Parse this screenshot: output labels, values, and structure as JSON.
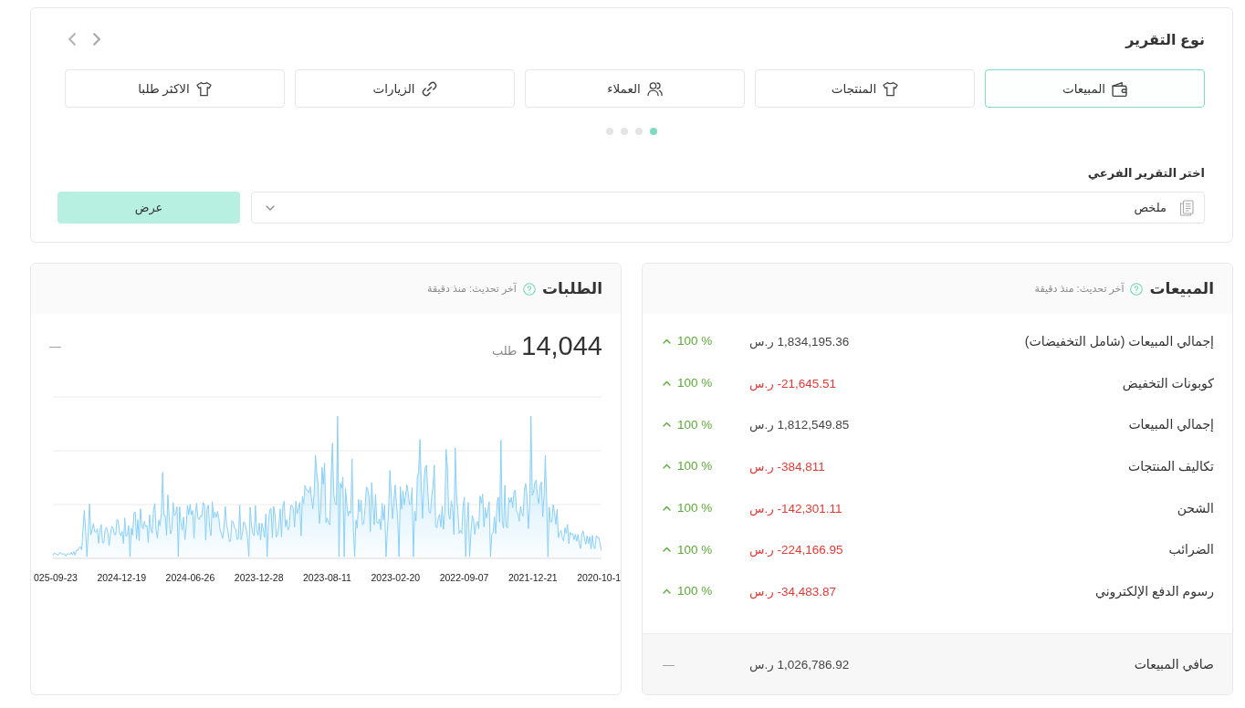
{
  "report_type": {
    "title": "نوع التقرير",
    "tabs": [
      {
        "label": "المبيعات",
        "selected": true
      },
      {
        "label": "المنتجات",
        "selected": false
      },
      {
        "label": "العملاء",
        "selected": false
      },
      {
        "label": "الزيارات",
        "selected": false
      },
      {
        "label": "الاكثر طلبا",
        "selected": false
      }
    ],
    "pager_dots": [
      {
        "selected": true
      },
      {
        "selected": false
      },
      {
        "selected": false
      },
      {
        "selected": false
      }
    ]
  },
  "sub_report": {
    "label": "اختر التقرير الفرعي",
    "select": {
      "value": "ملخص"
    },
    "button": "عرض"
  },
  "sales_card": {
    "title": "المبيعات",
    "updated": "آخر تحديث: منذ دقيقة",
    "rows": [
      {
        "label": "إجمالي المبيعات (شامل التخفيضات)",
        "amount": "1,834,195.36",
        "currency": "ر.س",
        "negative": false,
        "change": "100 %",
        "rising": true
      },
      {
        "label": "كوبونات التخفيض",
        "amount": "-21,645.51",
        "currency": "ر.س",
        "negative": true,
        "change": "100 %",
        "rising": true
      },
      {
        "label": "إجمالي المبيعات",
        "amount": "1,812,549.85",
        "currency": "ر.س",
        "negative": false,
        "change": "100 %",
        "rising": true
      },
      {
        "label": "تكاليف المنتجات",
        "amount": "-384,811",
        "currency": "ر.س",
        "negative": true,
        "change": "100 %",
        "rising": true
      },
      {
        "label": "الشحن",
        "amount": "-142,301.11",
        "currency": "ر.س",
        "negative": true,
        "change": "100 %",
        "rising": true
      },
      {
        "label": "الضرائب",
        "amount": "-224,166.95",
        "currency": "ر.س",
        "negative": true,
        "change": "100 %",
        "rising": true
      },
      {
        "label": "رسوم الدفع الإلكتروني",
        "amount": "-34,483.87",
        "currency": "ر.س",
        "negative": true,
        "change": "100 %",
        "rising": true
      }
    ],
    "footer": {
      "label": "صافي المبيعات",
      "amount": "1,026,786.92",
      "currency": "ر.س",
      "change": "—"
    }
  },
  "orders_card": {
    "title": "الطلبات",
    "updated": "آخر تحديث: منذ دقيقة",
    "total": "14,044",
    "unit": "طلب",
    "comparison": "—",
    "chart": {
      "x_labels": [
        "2020-10-1",
        "2021-12-21",
        "2022-09-07",
        "2023-02-20",
        "2023-08-11",
        "2023-12-28",
        "2024-06-26",
        "2024-12-19",
        "025-09-23"
      ]
    }
  }
}
